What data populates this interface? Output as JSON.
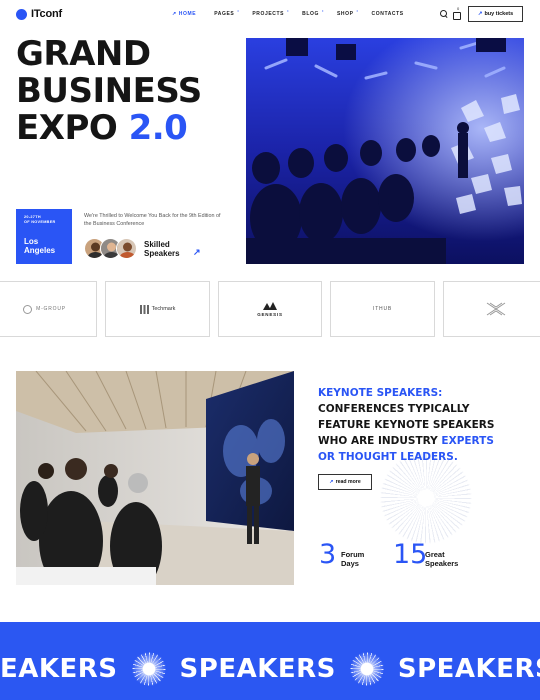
{
  "header": {
    "logo_text": "ITconf",
    "nav": [
      {
        "label": "HOME",
        "active": true
      },
      {
        "label": "PAGES",
        "active": false
      },
      {
        "label": "PROJECTS",
        "active": false
      },
      {
        "label": "BLOG",
        "active": false
      },
      {
        "label": "SHOP",
        "active": false
      },
      {
        "label": "CONTACTS",
        "active": false
      }
    ],
    "cart_count": "0",
    "buy_label": "buy tickets"
  },
  "hero": {
    "title_line1": "GRAND",
    "title_line2": "BUSINESS",
    "title_line3_a": "EXPO",
    "title_line3_b": "2.0",
    "date_range": "20-27th",
    "date_month": "of November",
    "city": "Los Angeles",
    "welcome_text": "We're Thrilled to Welcome You Back for the 9th Edition of the Business Conference",
    "skilled_line1": "Skilled",
    "skilled_line2": "Speakers"
  },
  "partners": [
    {
      "name": "M-GROUP"
    },
    {
      "name": "Techmark"
    },
    {
      "name": "GENESIS"
    },
    {
      "name": "ITHUB"
    },
    {
      "name": ""
    }
  ],
  "keynote": {
    "heading_blue": "KEYNOTE SPEAKERS:",
    "line2": "CONFERENCES TYPICALLY",
    "line3": "FEATURE KEYNOTE SPEAKERS",
    "line4_a": "WHO ARE INDUSTRY",
    "line4_b": "EXPERTS",
    "line5": "OR THOUGHT LEADERS.",
    "read_more": "read more",
    "stats": [
      {
        "value": "3",
        "label1": "Forum",
        "label2": "Days"
      },
      {
        "value": "15",
        "label1": "Great",
        "label2": "Speakers"
      }
    ]
  },
  "band": {
    "word_start": "EAKERS",
    "word": "SPEAKERS"
  },
  "colors": {
    "accent": "#2a55f5",
    "band": "#2b57f2",
    "text": "#151515"
  }
}
